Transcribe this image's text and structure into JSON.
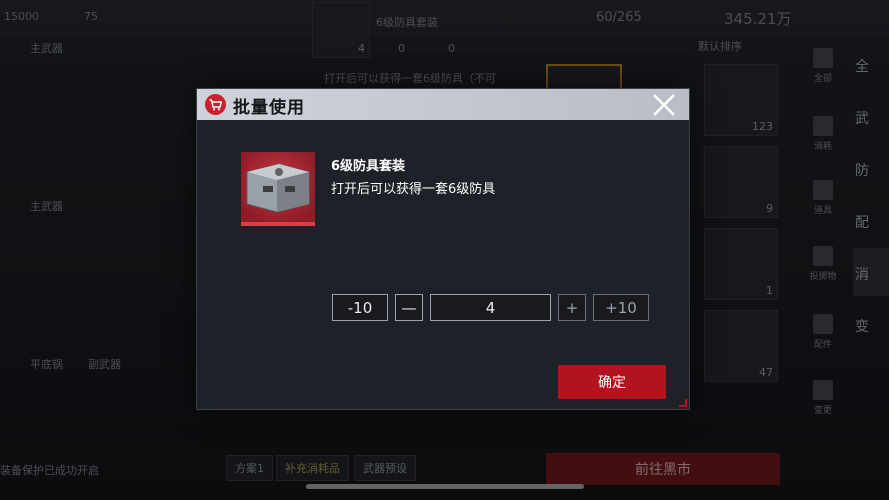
{
  "background": {
    "top_stats": {
      "currency_a": "15000",
      "currency_b": "75",
      "capacity": "60/265",
      "money": "345.21万"
    },
    "selected_item": {
      "title": "6级防具套装",
      "count": "4",
      "sub_a": "0",
      "sub_b": "0"
    },
    "sort_label": "默认排序",
    "left_labels": [
      "主武器",
      "主武器",
      "平底锅",
      "副武器"
    ],
    "hint_text": "打开后可以获得一套6级防具（不可",
    "grid_counts": [
      "123",
      "9",
      "1",
      "47"
    ],
    "side_categories": [
      "全部",
      "消耗",
      "道具",
      "投掷物",
      "配件",
      "变更"
    ],
    "far_right_tabs": [
      "全",
      "武",
      "防",
      "配",
      "消",
      "变"
    ],
    "bottom_bar": {
      "status": "装备保护已成功开启",
      "plan": "方案1",
      "supply": "补充消耗品",
      "weapon": "武器预设",
      "black_market": "前往黑市"
    }
  },
  "dialog": {
    "title": "批量使用",
    "close_label": "✕",
    "item": {
      "name": "6级防具套装",
      "description": "打开后可以获得一套6级防具"
    },
    "stepper": {
      "minus10": "-10",
      "minus1": "—",
      "quantity": "4",
      "plus1": "+",
      "plus10": "+10"
    },
    "confirm_label": "确定"
  },
  "colors": {
    "accent_red": "#b3121f",
    "header_grey": "#c4c8cf",
    "dialog_bg": "#1e2128"
  },
  "icons": {
    "cart": "shopping-cart-icon",
    "close": "close-icon",
    "item": "armor-case-icon"
  }
}
